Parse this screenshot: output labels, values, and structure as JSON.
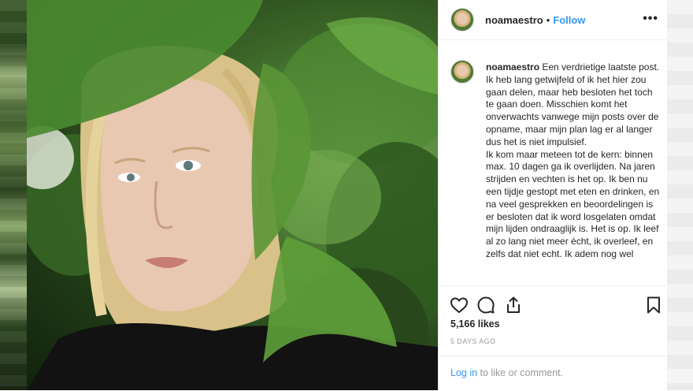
{
  "post": {
    "username": "noamaestro",
    "separator": "•",
    "follow_label": "Follow",
    "more_label": "•••",
    "caption": " Een verdrietige laatste post. Ik heb lang getwijfeld of ik het hier zou gaan delen, maar heb besloten het toch te gaan doen. Misschien komt het onverwachts vanwege mijn posts over de opname, maar mijn plan lag er al langer dus het is niet impulsief.\nIk kom maar meteen tot de kern: binnen max. 10 dagen ga ik overlijden. Na jaren strijden en vechten is het op. Ik ben nu een tijdje gestopt met eten en drinken, en na veel gesprekken en beoordelingen is er besloten dat ik word losgelaten omdat mijn lijden ondraaglijk is. Het is op. Ik leef al zo lang niet meer écht, ik overleef, en zelfs dat niet echt. Ik adem nog wel",
    "likes": "5,166 likes",
    "timestamp": "5 DAYS AGO",
    "login_link": "Log in",
    "login_suffix": " to like or comment."
  },
  "icons": {
    "like": "heart-outline",
    "comment": "speech-bubble",
    "share": "share-arrow",
    "save": "bookmark"
  },
  "colors": {
    "link_blue": "#3897f0",
    "text": "#262626",
    "muted": "#999999"
  }
}
